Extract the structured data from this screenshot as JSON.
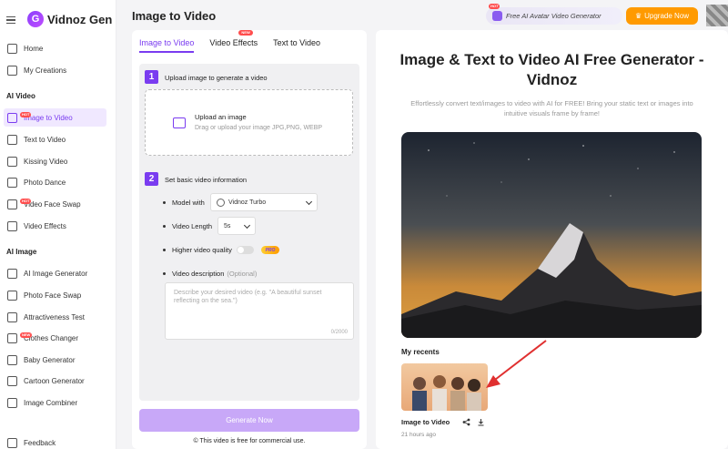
{
  "brand": {
    "name": "Vidnoz Gen"
  },
  "sidebar": {
    "top_items": [
      {
        "label": "Home",
        "icon": "home-icon"
      },
      {
        "label": "My Creations",
        "icon": "folder-icon"
      }
    ],
    "sections": [
      {
        "title": "AI Video",
        "items": [
          {
            "label": "Image to Video",
            "icon": "image-video-icon",
            "badge": "HOT",
            "active": true
          },
          {
            "label": "Text to Video",
            "icon": "text-video-icon"
          },
          {
            "label": "Kissing Video",
            "icon": "kiss-icon"
          },
          {
            "label": "Photo Dance",
            "icon": "dance-icon"
          },
          {
            "label": "Video Face Swap",
            "icon": "face-swap-icon",
            "badge": "HOT"
          },
          {
            "label": "Video Effects",
            "icon": "effects-icon"
          }
        ]
      },
      {
        "title": "AI Image",
        "items": [
          {
            "label": "AI Image Generator",
            "icon": "image-generator-icon"
          },
          {
            "label": "Photo Face Swap",
            "icon": "photo-swap-icon"
          },
          {
            "label": "Attractiveness Test",
            "icon": "test-icon"
          },
          {
            "label": "Clothes Changer",
            "icon": "clothes-icon",
            "badge": "NEW"
          },
          {
            "label": "Baby Generator",
            "icon": "baby-icon"
          },
          {
            "label": "Cartoon Generator",
            "icon": "cartoon-icon"
          },
          {
            "label": "Image Combiner",
            "icon": "combiner-icon"
          }
        ]
      }
    ],
    "feedback": "Feedback"
  },
  "header": {
    "title": "Image to Video",
    "promo": {
      "label": "Free AI Avatar Video Generator",
      "badge": "HOT"
    },
    "upgrade_label": "Upgrade Now"
  },
  "tabs": [
    {
      "label": "Image to Video",
      "active": true
    },
    {
      "label": "Video Effects",
      "badge": "NEW"
    },
    {
      "label": "Text to Video"
    }
  ],
  "form": {
    "step1": {
      "num": "1",
      "title": "Upload image to generate a video"
    },
    "upload": {
      "title": "Upload an image",
      "sub": "Drag or upload your image JPG,PNG, WEBP"
    },
    "step2": {
      "num": "2",
      "title": "Set basic video information"
    },
    "model": {
      "label": "Model with",
      "value": "Vidnoz Turbo"
    },
    "length": {
      "label": "Video Length",
      "value": "5s"
    },
    "quality": {
      "label": "Higher video quality",
      "badge": "PRO",
      "enabled": false
    },
    "description": {
      "label": "Video description",
      "optional": "(Optional)",
      "placeholder": "Describe your desired video (e.g. \"A beautiful sunset reflecting on the sea.\")",
      "count": "0/2000"
    },
    "generate_label": "Generate Now",
    "free_note": "This video is free for commercial use."
  },
  "hero": {
    "title": "Image & Text to Video AI Free Generator - Vidnoz",
    "subtitle": "Effortlessly convert text/images to video with AI for FREE! Bring your static text or images into intuitive visuals frame by frame!"
  },
  "recents": {
    "title": "My recents",
    "items": [
      {
        "name": "Image to Video",
        "time": "21 hours ago"
      }
    ]
  },
  "colors": {
    "accent": "#7a3cf0",
    "upgrade": "#ff9a00",
    "hot": "#ff4d4d"
  }
}
